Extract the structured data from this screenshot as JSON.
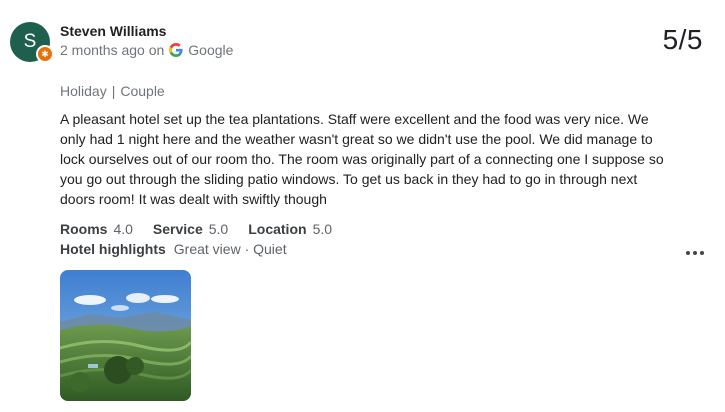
{
  "reviewer": {
    "initial": "S",
    "name": "Steven Williams",
    "time": "2 months ago on",
    "source": "Google"
  },
  "score": "5/5",
  "trip": {
    "type": "Holiday",
    "separator": "|",
    "group": "Couple"
  },
  "review_text": "A pleasant hotel set up the tea plantations. Staff were excellent and the food was very nice. We only had 1 night here and the weather wasn't great so we didn't use the pool. We did manage to lock ourselves out of our room tho. The room was originally part of a connecting one I suppose so you go out through the sliding patio windows. To get us back in they had to go in through next doors room! It was dealt with swiftly though",
  "ratings": [
    {
      "label": "Rooms",
      "value": "4.0"
    },
    {
      "label": "Service",
      "value": "5.0"
    },
    {
      "label": "Location",
      "value": "5.0"
    }
  ],
  "highlights": {
    "label": "Hotel highlights",
    "value": "Great view · Quiet"
  },
  "icons": {
    "source_logo": "google-g-icon",
    "more": "more-options-icon",
    "badge": "local-guide-badge-icon"
  },
  "colors": {
    "avatar_bg": "#1e5f4e",
    "badge": "#e8710a",
    "secondary_text": "#70757a"
  }
}
